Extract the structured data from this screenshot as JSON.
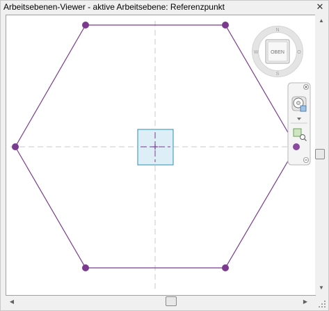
{
  "window": {
    "title": "Arbeitsebenen-Viewer - aktive Arbeitsebene: Referenzpunkt",
    "close_label": "✕"
  },
  "viewcube": {
    "face_label": "OBEN",
    "compass": {
      "north": "N",
      "east": "O",
      "south": "S",
      "west": "W"
    }
  },
  "colors": {
    "shape": "#7a3b8f",
    "work_plane_fill": "#ddeef6",
    "work_plane_border": "#2a8fb0",
    "crosshair": "#c8c8c8"
  },
  "navigation_bar": {
    "icons": [
      "close-icon",
      "steering-wheel-icon",
      "dropdown-arrow-icon",
      "zoom-region-icon",
      "collapse-icon"
    ]
  },
  "scrollbars": {
    "vertical_position": 0.5,
    "horizontal_position": 0.53
  }
}
